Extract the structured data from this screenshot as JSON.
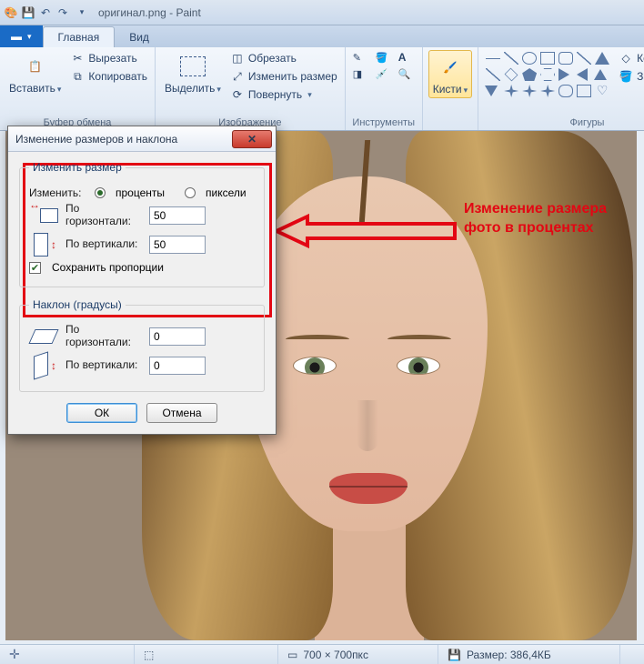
{
  "title": "оригинал.png - Paint",
  "tabs": {
    "file": "",
    "home": "Главная",
    "view": "Вид"
  },
  "ribbon": {
    "clipboard": {
      "label": "Буфер обмена",
      "paste": "Вставить",
      "cut": "Вырезать",
      "copy": "Копировать"
    },
    "image": {
      "label": "Изображение",
      "select": "Выделить",
      "crop": "Обрезать",
      "resize": "Изменить размер",
      "rotate": "Повернуть"
    },
    "tools": {
      "label": "Инструменты"
    },
    "brushes": {
      "label": "Кисти"
    },
    "shapes": {
      "label": "Фигуры",
      "outline": "Контур",
      "fill": "Заливка"
    }
  },
  "dialog": {
    "title": "Изменение размеров и наклона",
    "resize_group": "Изменить размер",
    "change_by": "Изменить:",
    "percent": "проценты",
    "pixels": "пиксели",
    "horizontal": "По горизонтали:",
    "vertical": "По вертикали:",
    "h_val": "50",
    "v_val": "50",
    "keep_ratio": "Сохранить пропорции",
    "skew_group": "Наклон (градусы)",
    "skew_h": "0",
    "skew_v": "0",
    "ok": "ОК",
    "cancel": "Отмена"
  },
  "annotation": "Изменение размера фото в процентах",
  "status": {
    "dims": "700 × 700пкс",
    "size": "Размер: 386,4КБ"
  }
}
